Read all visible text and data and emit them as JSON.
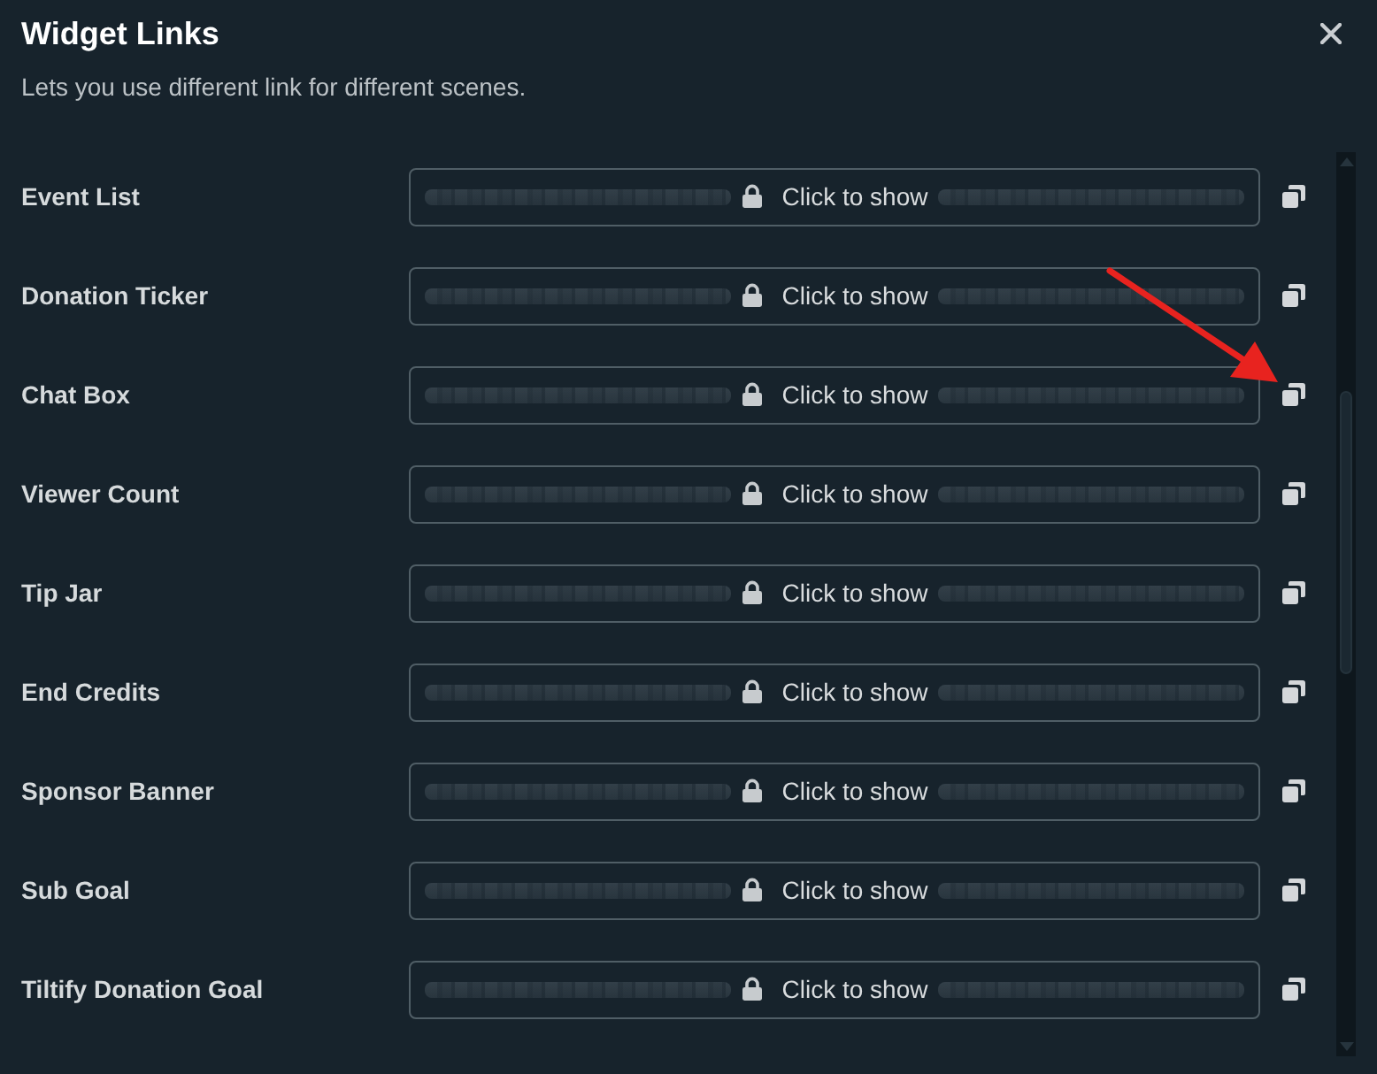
{
  "dialog": {
    "title": "Widget Links",
    "description": "Lets you use different link for different scenes."
  },
  "rows": [
    {
      "label": "Event List",
      "reveal": "Click to show"
    },
    {
      "label": "Donation Ticker",
      "reveal": "Click to show"
    },
    {
      "label": "Chat Box",
      "reveal": "Click to show"
    },
    {
      "label": "Viewer Count",
      "reveal": "Click to show"
    },
    {
      "label": "Tip Jar",
      "reveal": "Click to show"
    },
    {
      "label": "End Credits",
      "reveal": "Click to show"
    },
    {
      "label": "Sponsor Banner",
      "reveal": "Click to show"
    },
    {
      "label": "Sub Goal",
      "reveal": "Click to show"
    },
    {
      "label": "Tiltify Donation Goal",
      "reveal": "Click to show"
    }
  ],
  "annotation": {
    "kind": "arrow"
  }
}
